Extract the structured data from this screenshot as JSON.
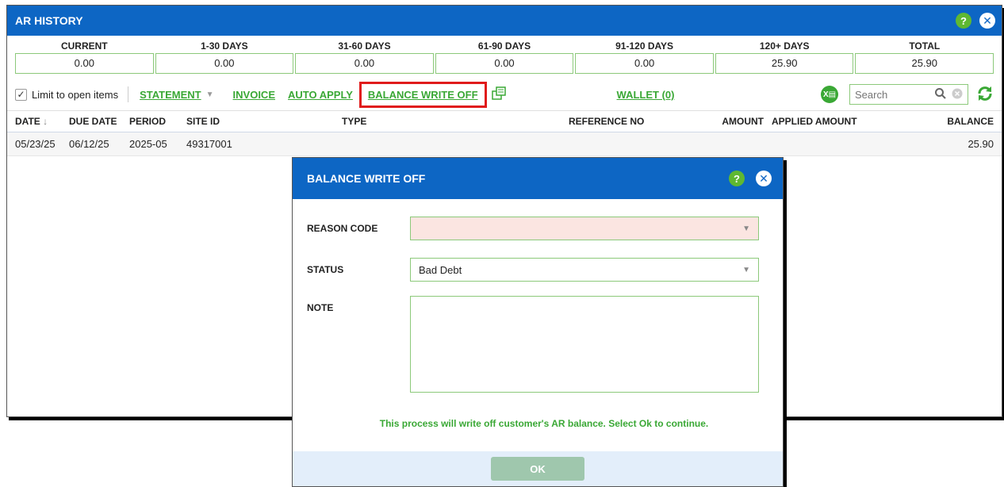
{
  "window": {
    "title": "AR HISTORY"
  },
  "aging": [
    {
      "label": "CURRENT",
      "value": "0.00"
    },
    {
      "label": "1-30 DAYS",
      "value": "0.00"
    },
    {
      "label": "31-60 DAYS",
      "value": "0.00"
    },
    {
      "label": "61-90 DAYS",
      "value": "0.00"
    },
    {
      "label": "91-120 DAYS",
      "value": "0.00"
    },
    {
      "label": "120+ DAYS",
      "value": "25.90"
    },
    {
      "label": "TOTAL",
      "value": "25.90"
    }
  ],
  "toolbar": {
    "limit_label": "Limit to open items",
    "limit_checked": true,
    "statement": "STATEMENT",
    "invoice": "INVOICE",
    "auto_apply": "AUTO APPLY",
    "balance_write_off": "BALANCE WRITE OFF",
    "wallet": "WALLET (0)",
    "search_placeholder": "Search"
  },
  "grid": {
    "columns": {
      "date": "DATE",
      "due_date": "DUE DATE",
      "period": "PERIOD",
      "site_id": "SITE ID",
      "type": "TYPE",
      "reference_no": "REFERENCE NO",
      "amount": "AMOUNT",
      "applied_amount": "APPLIED AMOUNT",
      "balance": "BALANCE"
    },
    "rows": [
      {
        "date": "05/23/25",
        "due_date": "06/12/25",
        "period": "2025-05",
        "site_id": "49317001",
        "balance": "25.90"
      }
    ]
  },
  "dialog": {
    "title": "BALANCE WRITE OFF",
    "reason_code_label": "REASON CODE",
    "reason_code_value": "",
    "status_label": "STATUS",
    "status_value": "Bad Debt",
    "note_label": "NOTE",
    "message": "This process will write off customer's AR balance. Select Ok to continue.",
    "ok_label": "OK"
  },
  "colors": {
    "header_blue": "#0d66c4",
    "link_green": "#3aa835",
    "help_green": "#5fb832",
    "highlight_red": "#e01b1b",
    "required_pink": "#fbe5e1"
  }
}
